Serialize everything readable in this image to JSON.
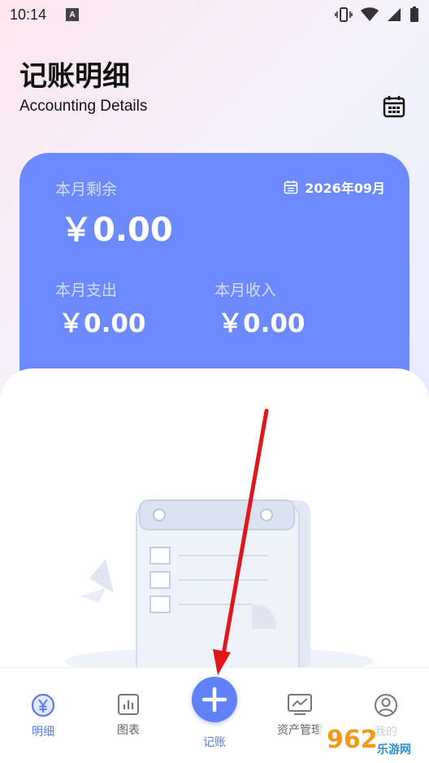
{
  "status_bar": {
    "time": "10:14",
    "app_badge": "A"
  },
  "header": {
    "title": "记账明细",
    "subtitle": "Accounting Details"
  },
  "summary": {
    "month": "2026年09月",
    "remaining_label": "本月剩余",
    "remaining_value": "￥0.00",
    "expense_label": "本月支出",
    "expense_value": "￥0.00",
    "income_label": "本月收入",
    "income_value": "￥0.00"
  },
  "nav": {
    "items": [
      {
        "label": "明细",
        "icon": "yen-circle-icon",
        "active": true
      },
      {
        "label": "图表",
        "icon": "bar-chart-icon",
        "active": false
      },
      {
        "label": "记账",
        "icon": "plus-icon",
        "active": false
      },
      {
        "label": "资产管理",
        "icon": "line-chart-monitor-icon",
        "active": false
      },
      {
        "label": "我的",
        "icon": "user-icon",
        "active": false
      }
    ]
  },
  "watermark": {
    "text_number": "962",
    "text_domain": "乐游网"
  },
  "colors": {
    "card": "#6b8afd",
    "accent": "#5a7cf6",
    "arrow": "#e0181c"
  }
}
